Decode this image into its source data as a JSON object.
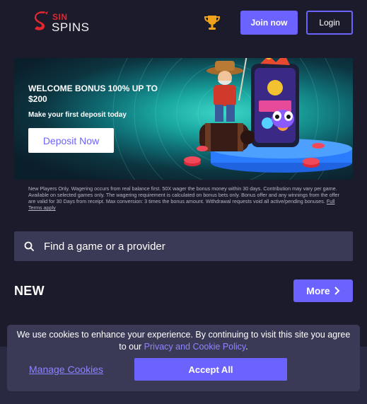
{
  "header": {
    "logo": {
      "line1": "SIN",
      "line2": "SPINS"
    },
    "trophy_icon": "trophy-icon",
    "join_label": "Join now",
    "login_label": "Login"
  },
  "banner": {
    "title": "WELCOME BONUS 100% UP TO $200",
    "subtitle": "Make your first deposit today",
    "deposit_label": "Deposit Now"
  },
  "terms": {
    "text": "New Players Only. Wagering occurs from real balance first. 50X wager the bonus money within 30 days. Contribution may vary per game. Available on selected games only. The wagering requirement is calculated on bonus bets only. Bonus offer and any winnings from the offer are valid for 30 Days from receipt. Max conversion: 3 times the bonus amount. Withdrawal requests void all active/pending bonuses.",
    "link": "Full Terms apply"
  },
  "search": {
    "placeholder": "Find a game or a provider",
    "icon": "search-icon"
  },
  "section": {
    "title": "NEW",
    "more_label": "More"
  },
  "cookie": {
    "text_before": "We use cookies to enhance your experience. By continuing to visit this site you agree to our ",
    "link": "Privacy and Cookie Policy",
    "text_after": ".",
    "manage_label": "Manage Cookies",
    "accept_label": "Accept All"
  },
  "colors": {
    "background": "#1c1b2b",
    "accent": "#6c63ff",
    "panel": "#3b3a56",
    "brand_red": "#e0282e"
  }
}
